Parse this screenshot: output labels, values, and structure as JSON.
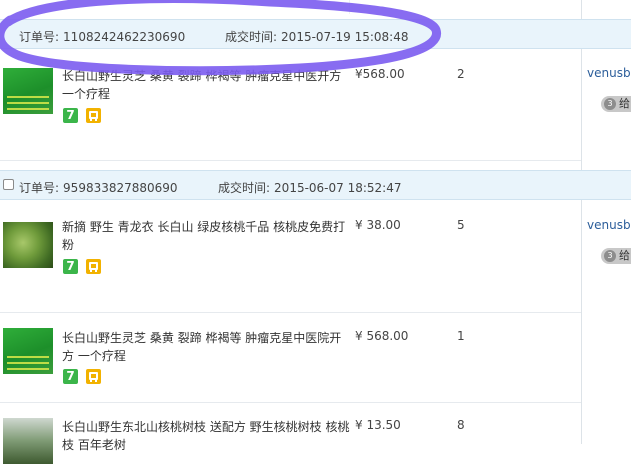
{
  "orders": [
    {
      "order_label": "订单号:",
      "order_no": "1108242462230690",
      "time_label": "成交时间:",
      "time": "2015-07-19 15:08:48",
      "items": [
        {
          "title": "长白山野生灵芝 桑黄 裂蹄 桦褐等 肿瘤克星中医开方 一个疗程",
          "price": "¥568.00",
          "qty": "2"
        }
      ],
      "seller": "venusbb",
      "review_label": "给"
    },
    {
      "order_label": "订单号:",
      "order_no": "959833827880690",
      "time_label": "成交时间:",
      "time": "2015-06-07 18:52:47",
      "items": [
        {
          "title": "新摘 野生 青龙衣 长白山 绿皮核桃千品 核桃皮免费打粉",
          "price": "¥ 38.00",
          "qty": "5"
        },
        {
          "title": "长白山野生灵芝 桑黄 裂蹄 桦褐等 肿瘤克星中医院开方 一个疗程",
          "price": "¥ 568.00",
          "qty": "1"
        },
        {
          "title": "长白山野生东北山核桃树枝 送配方 野生核桃树枝 核桃枝 百年老树",
          "price": "¥ 13.50",
          "qty": "8"
        }
      ],
      "seller": "venusbb",
      "review_label": "给"
    }
  ],
  "badges": {
    "seven_day": "7"
  },
  "colors": {
    "highlight_circle": "#7b5cf0",
    "header_bg": "#e9f4fb",
    "link": "#2b5d9a"
  }
}
